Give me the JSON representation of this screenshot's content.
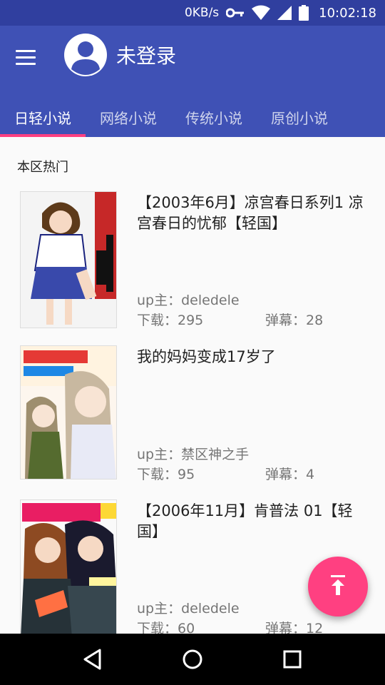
{
  "status_bar": {
    "net_speed": "0KB/s",
    "time": "10:02:18",
    "icons": [
      "key-icon",
      "wifi-icon",
      "signal-icon",
      "battery-icon"
    ]
  },
  "app_bar": {
    "title": "未登录",
    "menu_icon": "menu-icon",
    "avatar_icon": "account-circle-icon"
  },
  "tabs": [
    {
      "label": "日轻小说",
      "active": true
    },
    {
      "label": "网络小说",
      "active": false
    },
    {
      "label": "传统小说",
      "active": false
    },
    {
      "label": "原创小说",
      "active": false
    }
  ],
  "section": {
    "title": "本区热门"
  },
  "books": [
    {
      "title": "【2003年6月】凉宫春日系列1 凉宫春日的忧郁【轻国】",
      "up": "up主：deledele",
      "downloads": "下载：295",
      "danmaku": "弹幕：28"
    },
    {
      "title": "我的妈妈变成17岁了",
      "up": "up主：禁区神之手",
      "downloads": "下载：95",
      "danmaku": "弹幕：4"
    },
    {
      "title": "【2006年11月】肯普法 01【轻国】",
      "up": "up主：deledele",
      "downloads": "下载：60",
      "danmaku": "弹幕：12"
    }
  ],
  "fab": {
    "icon": "scroll-to-top-icon"
  },
  "nav_bar": {
    "icons": [
      "back-icon",
      "home-icon",
      "recents-icon"
    ]
  },
  "colors": {
    "primary": "#3f51b5",
    "primary_dark": "#303f9f",
    "accent": "#ff4081"
  }
}
